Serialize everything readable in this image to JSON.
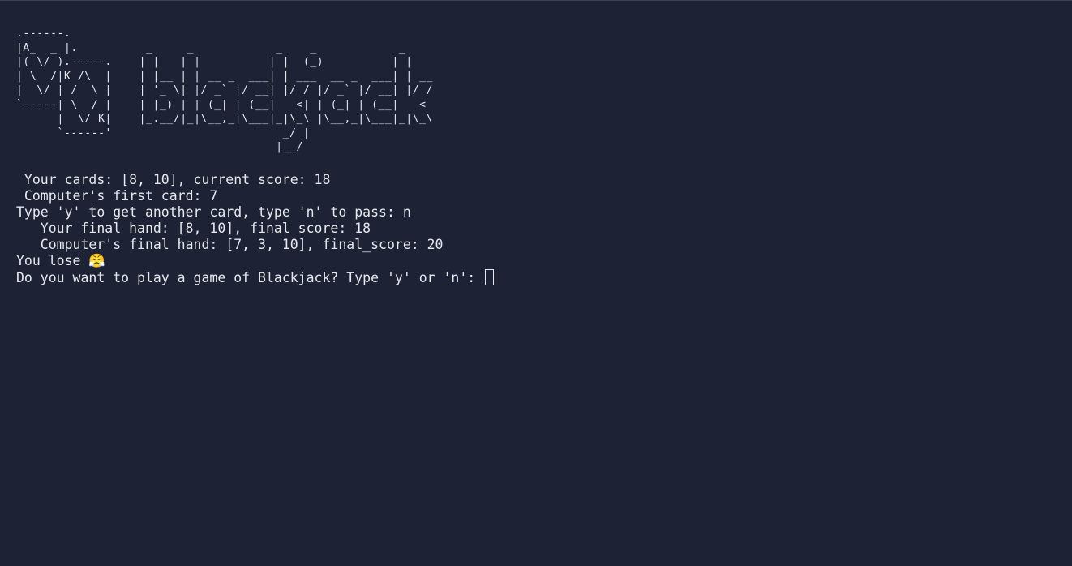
{
  "terminal": {
    "ascii_art": ".------.\n|A_  _ |.          _     _            _    _            _\n|( \\/ ).-----.    | |   | |          | |  (_)          | |\n| \\  /|K /\\  |    | |__ | | __ _  ___| | ___  __ _  ___| | __\n|  \\/ | /  \\ |    | '_ \\| |/ _` |/ __| |/ / |/ _` |/ __| |/ /\n`-----| \\  / |    | |_) | | (_| | (__|   <| | (_| | (__|   <\n      |  \\/ K|    |_.__/|_|\\__,_|\\___|_|\\_\\ |\\__,_|\\___|_|\\_\\\n      `------'                         _/ |\n                                      |__/",
    "lines": {
      "your_cards": " Your cards: [8, 10], current score: 18",
      "computer_first_card": " Computer's first card: 7",
      "hit_prompt": "Type 'y' to get another card, type 'n' to pass: n",
      "final_hand": "   Your final hand: [8, 10], final score: 18",
      "computer_final_hand": "   Computer's final hand: [7, 3, 10], final_score: 20",
      "result_text": "You lose ",
      "result_emoji": "😤",
      "play_again_prompt": "Do you want to play a game of Blackjack? Type 'y' or 'n': "
    },
    "input_value": ""
  }
}
